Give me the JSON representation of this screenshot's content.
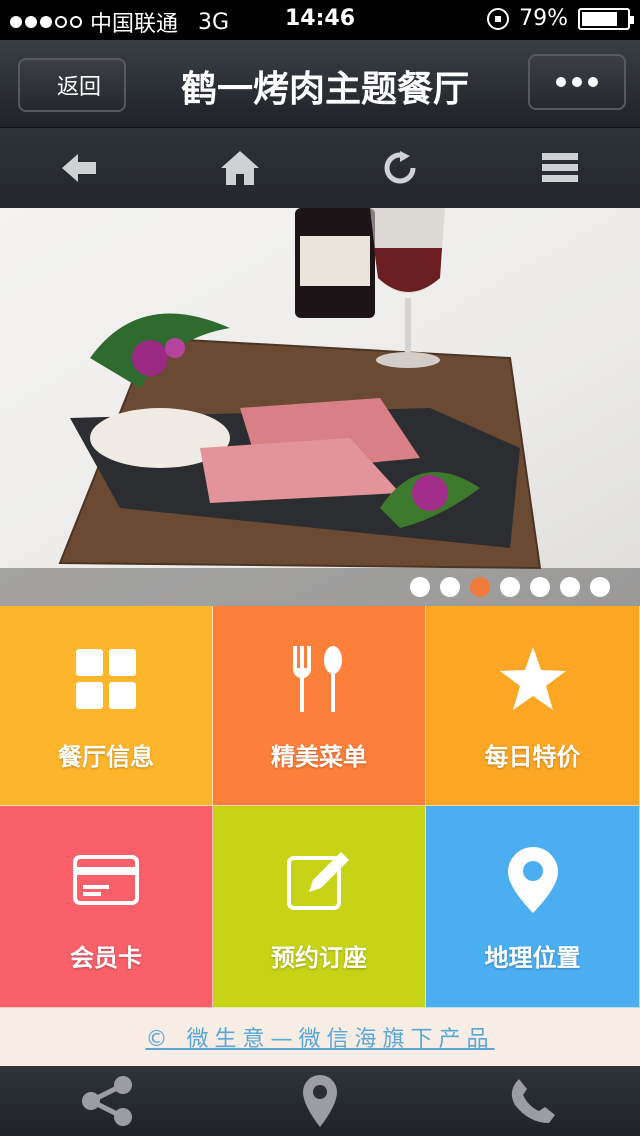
{
  "status_bar": {
    "carrier": "中国联通",
    "network": "3G",
    "time": "14:46",
    "battery": "79%",
    "battery_level": 0.79
  },
  "header": {
    "back_label": "返回",
    "title": "鹤一烤肉主题餐厅"
  },
  "toolbar": {
    "icons": [
      "back-arrow-icon",
      "home-icon",
      "refresh-icon",
      "menu-icon"
    ]
  },
  "banner": {
    "slide_count": 7,
    "active_index": 2,
    "colors": {
      "active": "#f07a3b",
      "inactive": "#ffffff"
    }
  },
  "tiles": [
    {
      "label": "餐厅信息",
      "icon": "grid-icon",
      "color": "#fdb52b"
    },
    {
      "label": "精美菜单",
      "icon": "fork-spoon-icon",
      "color": "#fc7f3a"
    },
    {
      "label": "每日特价",
      "icon": "star-icon",
      "color": "#fba624"
    },
    {
      "label": "会员卡",
      "icon": "card-icon",
      "color": "#f9606a"
    },
    {
      "label": "预约订座",
      "icon": "edit-icon",
      "color": "#c6d317"
    },
    {
      "label": "地理位置",
      "icon": "location-pin-icon",
      "color": "#4aaef0"
    }
  ],
  "footer": {
    "credit": "© 微生意—微信海旗下产品"
  },
  "bottom_bar": {
    "icons": [
      "share-icon",
      "map-pin-icon",
      "phone-icon"
    ]
  }
}
